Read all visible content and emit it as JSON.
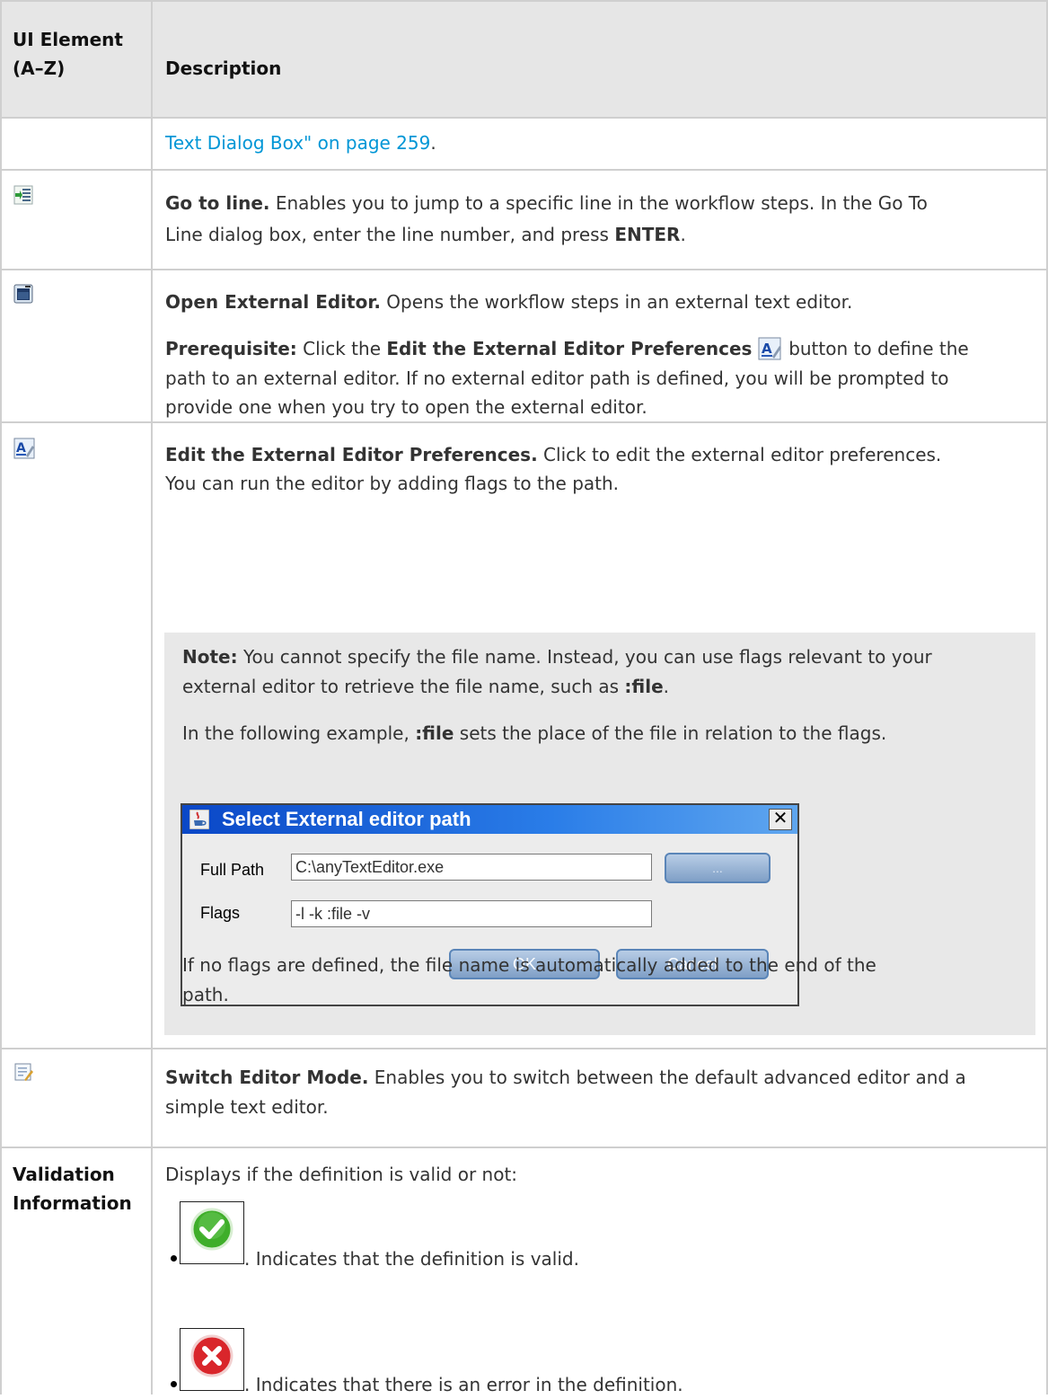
{
  "header": {
    "col1_line1": "UI Element",
    "col1_line2": "(A–Z)",
    "col2": "Description"
  },
  "rows": {
    "link_row": {
      "link_text": "Text Dialog Box\" on page 259",
      "suffix": "."
    },
    "go_to_line": {
      "icon": "go-to-line-icon",
      "title": "Go to line.",
      "line1": "Enables you to jump to a specific line in the workflow steps. In the Go To",
      "line2_a": "Line dialog box, enter the line number, and press ",
      "line2_key": "ENTER",
      "line2_end": "."
    },
    "open_external_editor": {
      "icon": "open-external-editor-icon",
      "title": "Open External Editor.",
      "desc": "Opens the workflow steps in an external text editor.",
      "prereq_label": "Prerequisite:",
      "prereq_a": "Click the",
      "prereq_bold": "Edit the External Editor Preferences",
      "prereq_b": "button to define the",
      "line2": "path to an external editor. If no external editor path is defined, you will be prompted to",
      "line3": "provide one when you try to open the external editor."
    },
    "edit_preferences": {
      "icon": "edit-preferences-icon",
      "title": "Edit the External Editor Preferences.",
      "line1": "Click to edit the external editor preferences.",
      "line2": "You can run the editor by adding flags to the path.",
      "note_label": "Note:",
      "note_line1": "You cannot specify the file name. Instead, you can use flags relevant to your",
      "note_line2_a": "external editor to retrieve the file name, such as ",
      "note_line2_code": ":file",
      "note_line2_end": ".",
      "example_a": "In the following example, ",
      "example_code": ":file",
      "example_b": " sets the place of the file in relation to the flags.",
      "footer_line1": "If no flags are defined, the file name is automatically added to the end of the",
      "footer_line2": "path."
    },
    "switch_editor_mode": {
      "icon": "switch-editor-mode-icon",
      "title": "Switch Editor Mode.",
      "line1": "Enables you to switch between the default advanced editor and a",
      "line2": "simple text editor."
    },
    "validation": {
      "label_line1": "Validation",
      "label_line2": "Information",
      "desc": "Displays if the definition is valid or not:",
      "valid_text": ". Indicates that the definition is valid.",
      "error_text": ". Indicates that there is an error in the definition."
    }
  },
  "dialog": {
    "title": "Select External editor path",
    "close": "✕",
    "full_path_label": "Full Path",
    "full_path_value": "C:\\anyTextEditor.exe",
    "browse_label": "...",
    "flags_label": "Flags",
    "flags_value": "-l -k :file -v",
    "ok_label": "OK",
    "cancel_label": "Cancel"
  },
  "colors": {
    "link": "#0096d6",
    "header_bg": "#e6e6e6",
    "note_bg": "#e8e8e8",
    "valid_green": "#3fae2a",
    "error_red": "#d9262b"
  }
}
